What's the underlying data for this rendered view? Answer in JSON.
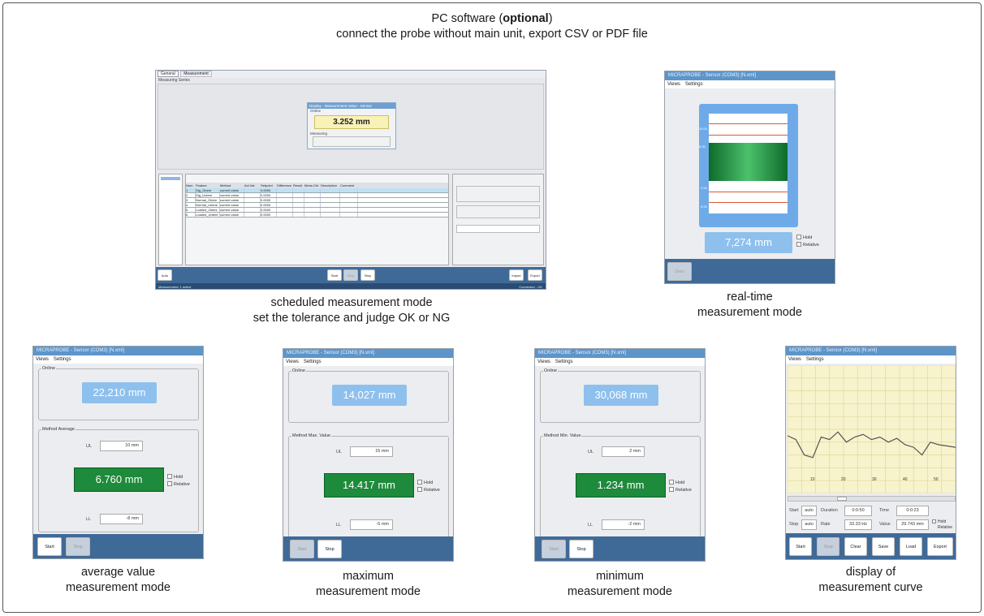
{
  "header": {
    "line1_before": "PC software (",
    "line1_bold": "optional",
    "line1_after": ")",
    "line2": "connect the probe without main unit, export CSV or PDF file"
  },
  "captions": {
    "scheduled": [
      "scheduled measurement mode",
      "set the tolerance and judge OK or NG"
    ],
    "realtime": [
      "real-time",
      "measurement mode"
    ],
    "average": [
      "average value",
      "measurement mode"
    ],
    "maximum": [
      "maximum",
      "measurement mode"
    ],
    "minimum": [
      "minimum",
      "measurement mode"
    ],
    "curve": [
      "display of",
      "measurement curve"
    ]
  },
  "window_title": "MICRAPROBE - Sensor (COM3) [N.xml]",
  "menu": {
    "views": "Views",
    "settings": "Settings"
  },
  "scheduled": {
    "tabs": [
      "General",
      "Measurement"
    ],
    "subtitle": "Measuring Series",
    "popup_title": "Display - Measurement Value - Sensor",
    "popup_group": "Online",
    "popup_value": "3.252 mm",
    "popup_group2": "Measuring",
    "table_headers": [
      "Num",
      "Feature",
      "Method",
      "Act.Val.",
      "Setpoint",
      "Difference",
      "Result",
      "Meas.Ctrl.",
      "Description",
      "Comment"
    ],
    "rows": [
      [
        "1",
        "Dig_Obere",
        "current value",
        "",
        "0.0000"
      ],
      [
        "2",
        "Dig_Untere",
        "current value",
        "",
        "0.0000"
      ],
      [
        "3",
        "Normal_Obere",
        "current value",
        "",
        "0.0000"
      ],
      [
        "4",
        "Normal_Untere",
        "current value",
        "",
        "0.0000"
      ],
      [
        "5",
        "Loaded_Obere",
        "current value",
        "",
        "0.0000"
      ],
      [
        "6",
        "Loaded_Untere",
        "current value",
        "",
        "0.0000"
      ]
    ],
    "btn_start": "Start",
    "btn_stop": "Stop",
    "btn_step": "Step",
    "btn_left": "Auto Meas.",
    "btn_import": "Import",
    "btn_export": "Export",
    "status_left": "Measurement: 1 active",
    "status_right": "Connected - OK"
  },
  "realtime": {
    "value": "7,274 mm",
    "hold": "Hold",
    "relative": "Relative",
    "scale": [
      "10.00",
      "8.00",
      "2.00",
      "0.00"
    ],
    "btn": "Zero"
  },
  "average": {
    "online_label": "Online",
    "online_value": "22,210 mm",
    "method_label": "Method Average",
    "us_label": "UL",
    "us_value": "10 mm",
    "result": "6.760 mm",
    "ls_label": "LL",
    "ls_value": "-8 mm",
    "hold": "Hold",
    "relative": "Relative",
    "btn_start": "Start",
    "btn_stop": "Stop"
  },
  "maximum": {
    "online_label": "Online",
    "online_value": "14,027 mm",
    "method_label": "Method Max. Value",
    "us_label": "UL",
    "us_value": "15 mm",
    "result": "14.417 mm",
    "ls_label": "LL",
    "ls_value": "-5 mm",
    "hold": "Hold",
    "relative": "Relative",
    "btn_start": "Start",
    "btn_stop": "Stop"
  },
  "minimum": {
    "online_label": "Online",
    "online_value": "30,068 mm",
    "method_label": "Method Min. Value",
    "us_label": "UL",
    "us_value": "2 mm",
    "result": "1.234 mm",
    "ls_label": "LL",
    "ls_value": "-2 mm",
    "hold": "Hold",
    "relative": "Relative",
    "btn_start": "Start",
    "btn_stop": "Stop"
  },
  "curve": {
    "axis_ticks": [
      "10",
      "20",
      "30",
      "40",
      "50"
    ],
    "start_label": "Start",
    "start_value": "auto",
    "stop_label": "Stop",
    "stop_value": "auto",
    "duration_label": "Duration",
    "duration_value": "0:0:50",
    "rate_label": "Rate",
    "rate_value": "33.33 Hz",
    "time_label": "Time",
    "time_value": "0:0:23",
    "value_label": "Value",
    "value_value": "29.743 mm",
    "hold": "Hold",
    "relative": "Relative",
    "buttons": [
      "Start",
      "Stop",
      "Clear",
      "Save",
      "Load",
      "Export"
    ],
    "chart_data": {
      "type": "line",
      "series": [
        {
          "values": [
            0.45,
            0.42,
            0.3,
            0.28,
            0.44,
            0.42,
            0.48,
            0.4,
            0.44,
            0.46,
            0.42,
            0.44,
            0.4,
            0.43,
            0.38,
            0.36,
            0.3,
            0.4,
            0.38,
            0.37,
            0.36
          ]
        }
      ],
      "ylim": [
        0,
        1
      ],
      "grid": true
    }
  },
  "colors": {
    "titlebar": "#5d95c9",
    "panel": "#ecedf0",
    "footer": "#3f6a98",
    "value_blue": "#8ec0ee",
    "value_green": "#1e8a3b",
    "chart_bg": "#f7f3cc"
  }
}
